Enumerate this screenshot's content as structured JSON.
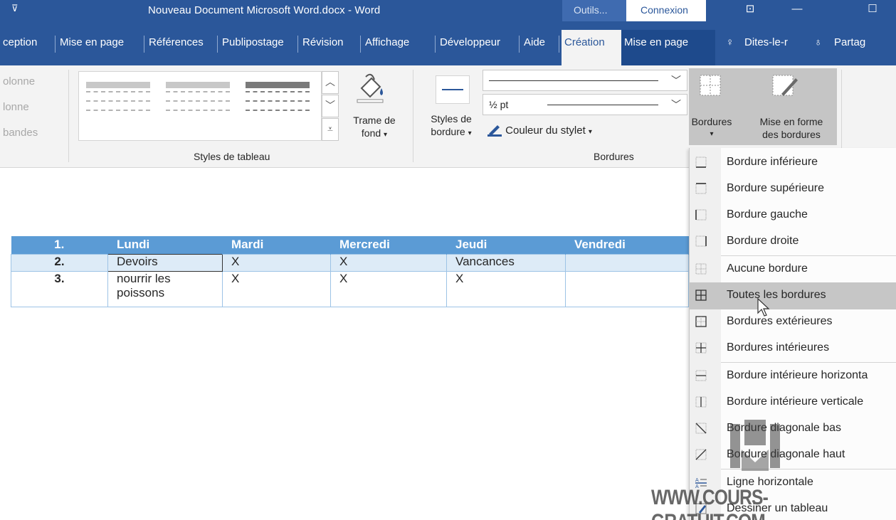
{
  "titlebar": {
    "title": "Nouveau Document Microsoft Word.docx  -  Word",
    "context_tools": "Outils...",
    "connect": "Connexion",
    "qat_icon": "chevron-down-icon",
    "colors": {
      "bar": "#2b579a",
      "context": "#1e4a8c"
    }
  },
  "tabs": [
    "ception",
    "Mise en page",
    "Références",
    "Publipostage",
    "Révision",
    "Affichage",
    "Développeur",
    "Aide",
    "Création",
    "Mise en page",
    "Dites-le-r",
    "Partag"
  ],
  "ribbon": {
    "style_options": [
      "olonne",
      "lonne",
      "bandes"
    ],
    "styles_group_label": "Styles de tableau",
    "shading_label_1": "Trame de",
    "shading_label_2": "fond",
    "border_styles_label_1": "Styles de",
    "border_styles_label_2": "bordure",
    "line_weight": "½ pt",
    "pen_color": "Couleur du stylet",
    "borders_group_label": "Bordures",
    "borders_button": "Bordures",
    "border_painter_1": "Mise en forme",
    "border_painter_2": "des bordures"
  },
  "table": {
    "headers": [
      "1.",
      "Lundi",
      "Mardi",
      "Mercredi",
      "Jeudi",
      "Vendredi"
    ],
    "rows": [
      [
        "2.",
        "Devoirs",
        "X",
        "X",
        "Vancances",
        ""
      ],
      [
        "3.",
        "nourrir les",
        "X",
        "X",
        "X",
        ""
      ]
    ],
    "row3_continuation": "poissons",
    "header_color": "#5b9bd5",
    "band_color": "#ddebf7"
  },
  "menu": {
    "items": [
      {
        "label": "Bordure inférieure",
        "icon": "border-bottom-icon"
      },
      {
        "label": "Bordure supérieure",
        "icon": "border-top-icon"
      },
      {
        "label": "Bordure gauche",
        "icon": "border-left-icon"
      },
      {
        "label": "Bordure droite",
        "icon": "border-right-icon"
      },
      {
        "label": "Aucune bordure",
        "icon": "no-border-icon"
      },
      {
        "label": "Toutes les bordures",
        "icon": "all-borders-icon"
      },
      {
        "label": "Bordures extérieures",
        "icon": "outside-borders-icon"
      },
      {
        "label": "Bordures intérieures",
        "icon": "inside-borders-icon"
      },
      {
        "label": "Bordure intérieure horizonta",
        "icon": "inside-horizontal-border-icon"
      },
      {
        "label": "Bordure intérieure verticale",
        "icon": "inside-vertical-border-icon"
      },
      {
        "label": "Bordure diagonale bas",
        "icon": "diagonal-down-border-icon"
      },
      {
        "label": "Bordure diagonale haut",
        "icon": "diagonal-up-border-icon"
      },
      {
        "label": "Ligne horizontale",
        "icon": "horizontal-line-icon"
      },
      {
        "label": "Dessiner un tableau",
        "icon": "draw-table-icon"
      }
    ],
    "hover_color": "#c6c6c6"
  },
  "watermark": "WWW.COURS-GRATUIT.COM"
}
